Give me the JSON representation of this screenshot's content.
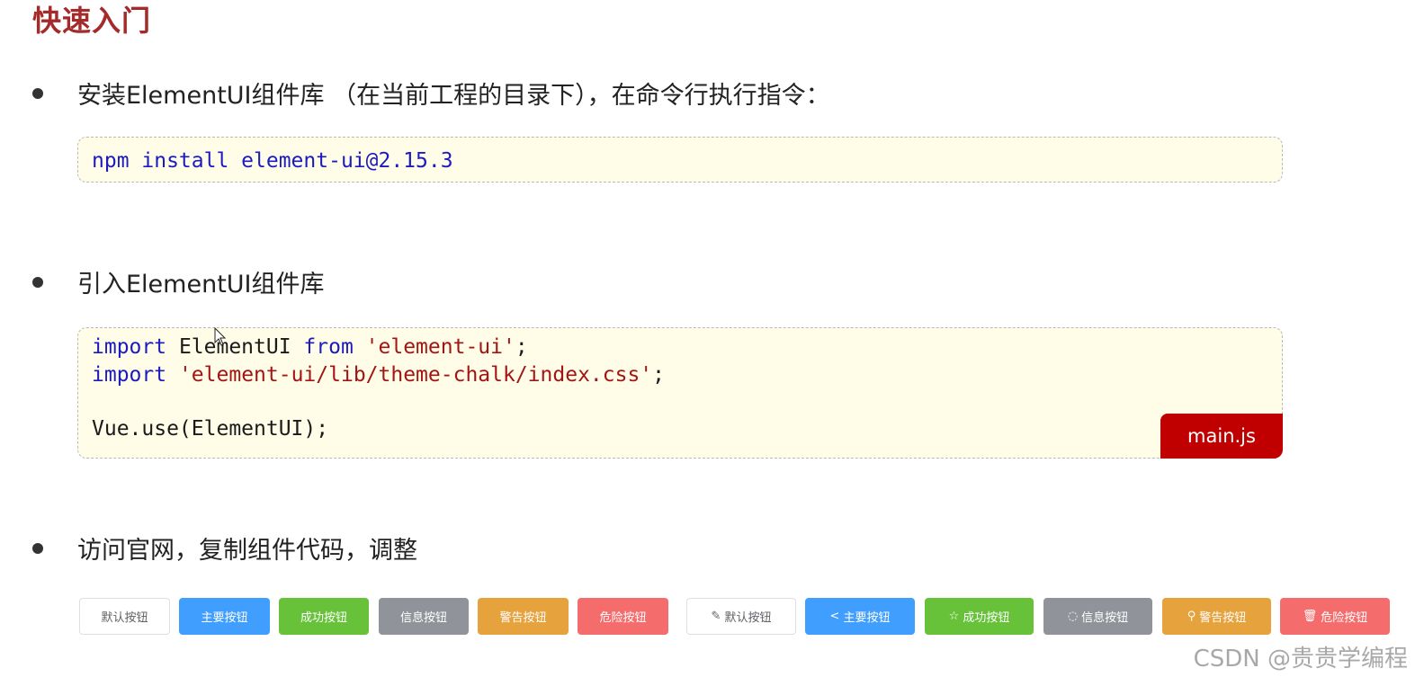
{
  "title": "快速入门",
  "bullets": [
    {
      "text": "安装ElementUI组件库 （在当前工程的目录下），在命令行执行指令："
    },
    {
      "text": "引入ElementUI组件库"
    },
    {
      "text": "访问官网，复制组件代码，调整"
    }
  ],
  "install_code": {
    "line": "npm install element-ui@2.15.3"
  },
  "import_code": {
    "line1": {
      "kw": "import",
      "plain": " ElementUI ",
      "kw2": "from",
      "str": "'element-ui'",
      "end": ";"
    },
    "line2": {
      "kw": "import",
      "str": "'element-ui/lib/theme-chalk/index.css'",
      "end": ";"
    },
    "line3": "Vue.use(ElementUI);",
    "file_tag": "main.js"
  },
  "buttons_plain": [
    {
      "label": "默认按钮",
      "type": "default"
    },
    {
      "label": "主要按钮",
      "type": "primary"
    },
    {
      "label": "成功按钮",
      "type": "success"
    },
    {
      "label": "信息按钮",
      "type": "info"
    },
    {
      "label": "警告按钮",
      "type": "warning"
    },
    {
      "label": "危险按钮",
      "type": "danger"
    }
  ],
  "buttons_icon": [
    {
      "label": "默认按钮",
      "type": "default",
      "icon": "edit-icon"
    },
    {
      "label": "主要按钮",
      "type": "primary",
      "icon": "share-icon"
    },
    {
      "label": "成功按钮",
      "type": "success",
      "icon": "star-icon"
    },
    {
      "label": "信息按钮",
      "type": "info",
      "icon": "message-icon"
    },
    {
      "label": "警告按钮",
      "type": "warning",
      "icon": "search-icon"
    },
    {
      "label": "危险按钮",
      "type": "danger",
      "icon": "delete-icon"
    }
  ],
  "colors": {
    "title": "#a52a2a",
    "code_bg": "#fffde8",
    "keyword": "#1b1bbf",
    "string": "#a31515",
    "file_tag": "#c00000",
    "primary": "#409eff",
    "success": "#67c23a",
    "info": "#909399",
    "warning": "#e6a23c",
    "danger": "#f56c6c"
  },
  "watermark": "CSDN @贵贵学编程"
}
